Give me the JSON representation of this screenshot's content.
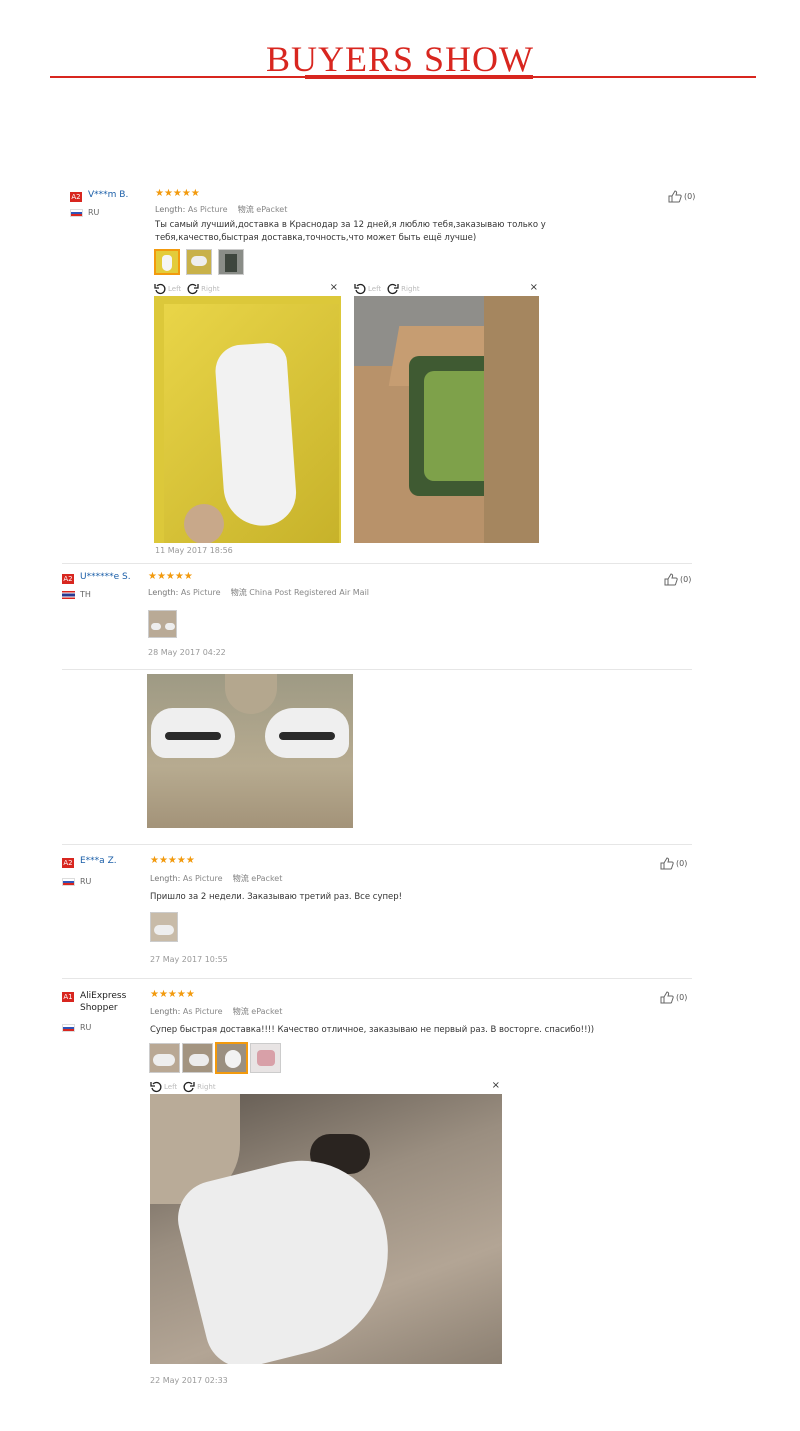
{
  "banner": {
    "title": "BUYERS SHOW"
  },
  "reviews": [
    {
      "badge": "A2",
      "name": "V***m B.",
      "country": "RU",
      "stars": "★★★★★",
      "length_key": "Length:",
      "length_val": "As Picture",
      "ship_key": "物流",
      "ship_val": "ePacket",
      "comment": "Ты самый лучший,доставка в Краснодар за 12 дней,я люблю тебя,заказываю только у тебя,качество,быстрая доставка,точность,что может быть ещё лучше)",
      "date": "11 May 2017 18:56",
      "likes": "(0)"
    },
    {
      "badge": "A2",
      "name": "U******e S.",
      "country": "TH",
      "stars": "★★★★★",
      "length_key": "Length:",
      "length_val": "As Picture",
      "ship_key": "物流",
      "ship_val": "China Post Registered Air Mail",
      "comment": "",
      "date": "28 May 2017 04:22",
      "likes": "(0)"
    },
    {
      "badge": "A2",
      "name": "E***a Z.",
      "country": "RU",
      "stars": "★★★★★",
      "length_key": "Length:",
      "length_val": "As Picture",
      "ship_key": "物流",
      "ship_val": "ePacket",
      "comment": "Пришло за 2 недели. Заказываю третий раз. Все супер!",
      "date": "27 May 2017 10:55",
      "likes": "(0)"
    },
    {
      "badge": "A1",
      "name": "AliExpress Shopper",
      "country": "RU",
      "stars": "★★★★★",
      "length_key": "Length:",
      "length_val": "As Picture",
      "ship_key": "物流",
      "ship_val": "ePacket",
      "comment": "Супер быстрая доставка!!!! Качество отличное, заказываю не первый раз. В восторге. спасибо!!))",
      "date": "22 May 2017 02:33",
      "likes": "(0)"
    }
  ],
  "viewer": {
    "left_label": "Left",
    "right_label": "Right",
    "close": "×"
  },
  "icons": {
    "thumbs_up": "thumbs-up-icon",
    "rotate_left": "rotate-left-icon",
    "rotate_right": "rotate-right-icon",
    "close": "close-icon"
  },
  "colors": {
    "accent": "#d8261f",
    "star": "#f29a0e",
    "link": "#1a5ea8"
  }
}
